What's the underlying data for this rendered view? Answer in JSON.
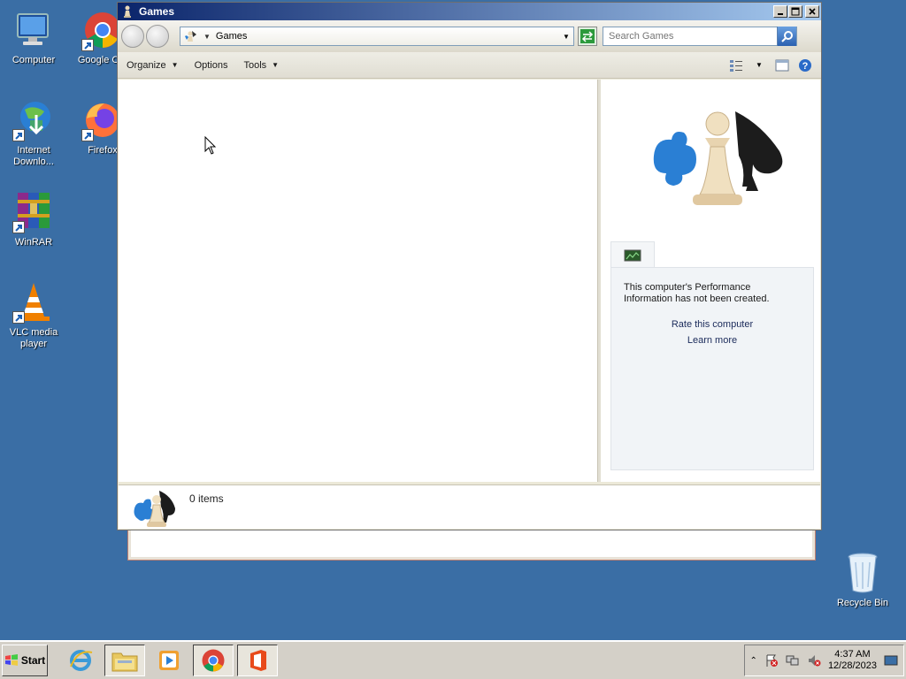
{
  "desktop": {
    "icons": [
      {
        "label": "Computer"
      },
      {
        "label": "Google Chr"
      },
      {
        "label": "Internet Downlo..."
      },
      {
        "label": "Firefox"
      },
      {
        "label": "WinRAR"
      },
      {
        "label": "VLC media player"
      },
      {
        "label": "Recycle Bin"
      }
    ]
  },
  "window": {
    "title": "Games",
    "address": "Games",
    "search_placeholder": "Search Games",
    "toolbar": {
      "organize": "Organize",
      "options": "Options",
      "tools": "Tools"
    },
    "preview": {
      "perf_text": "This computer's Performance Information has not been created.",
      "rate_link": "Rate this computer",
      "learn_link": "Learn more"
    },
    "details": {
      "item_count": "0 items"
    }
  },
  "taskbar": {
    "start_label": "Start",
    "clock_time": "4:37 AM",
    "clock_date": "12/28/2023"
  },
  "colors": {
    "desktop": "#3a6ea5",
    "title_start": "#0a246a",
    "title_end": "#a6caf0"
  }
}
